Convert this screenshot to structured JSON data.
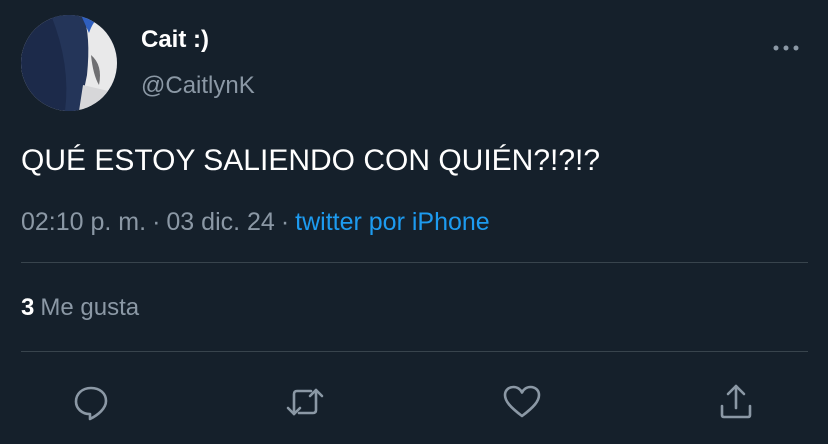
{
  "tweet": {
    "author": {
      "display_name": "Cait :)",
      "handle": "@CaitlynK",
      "avatar_icon": "profile-photo"
    },
    "text": "QUÉ ESTOY SALIENDO CON QUIÉN?!?!?",
    "time": "02:10 p. m.",
    "date": "03 dic. 24",
    "separator": "·",
    "source": "twitter por iPhone",
    "likes": {
      "count": "3",
      "label": "Me gusta"
    },
    "actions": [
      {
        "name": "reply",
        "icon": "reply-icon"
      },
      {
        "name": "retweet",
        "icon": "retweet-icon"
      },
      {
        "name": "like",
        "icon": "heart-icon"
      },
      {
        "name": "share",
        "icon": "share-icon"
      }
    ]
  },
  "colors": {
    "background": "#15202b",
    "primary_text": "#ffffff",
    "secondary_text": "#8b98a5",
    "accent": "#1d9bf0",
    "divider": "#38444d"
  }
}
